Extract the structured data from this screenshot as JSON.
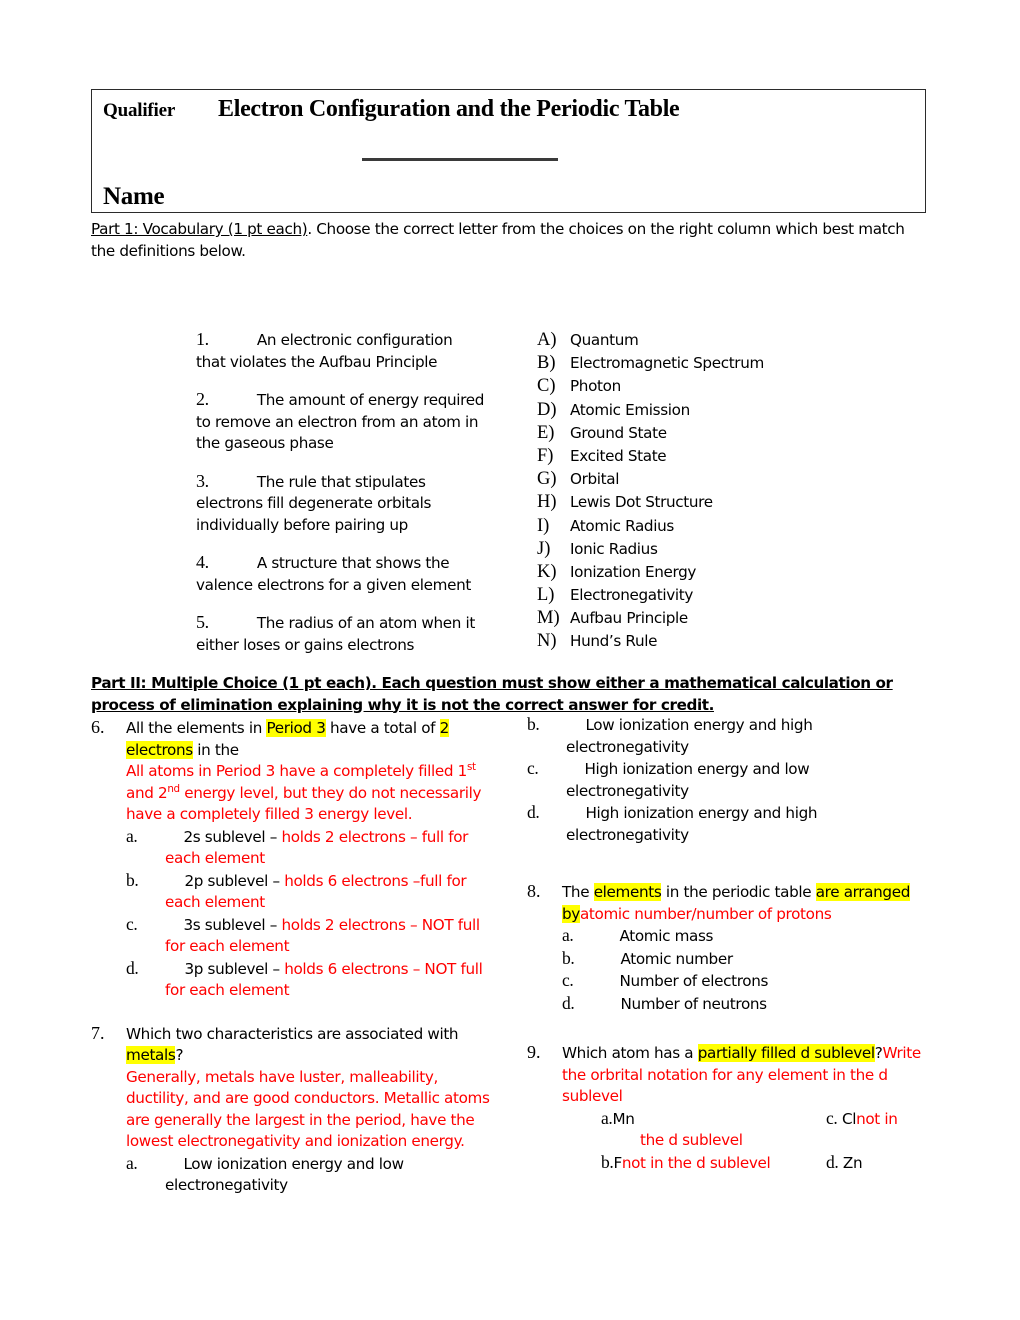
{
  "header": {
    "qualifier": "Qualifier",
    "title": "Electron Configuration and the Periodic Table",
    "name_label": "Name",
    "blank_line": "____________________"
  },
  "part1": {
    "heading_underlined": "Part 1:  Vocabulary (1 pt each)",
    "instructions": ".  Choose the correct letter from the choices on the right column which best match the definitions below.",
    "definitions": [
      {
        "num": "1.",
        "text": "An electronic configuration that violates the Aufbau Principle"
      },
      {
        "num": "2.",
        "text": "The amount of energy required to remove an electron from an atom in the gaseous phase"
      },
      {
        "num": "3.",
        "text": "The rule that stipulates electrons fill degenerate orbitals individually before pairing up"
      },
      {
        "num": "4.",
        "text": "A structure that shows the valence electrons for a given element"
      },
      {
        "num": "5.",
        "text": "The radius of an atom when it either loses or gains electrons"
      }
    ],
    "choices": [
      {
        "letter": "A)",
        "term": "Quantum"
      },
      {
        "letter": "B)",
        "term": "Electromagnetic Spectrum"
      },
      {
        "letter": "C)",
        "term": "Photon"
      },
      {
        "letter": "D)",
        "term": "Atomic Emission"
      },
      {
        "letter": "E)",
        "term": "Ground State"
      },
      {
        "letter": "F)",
        "term": "Excited State"
      },
      {
        "letter": "G)",
        "term": "Orbital"
      },
      {
        "letter": "H)",
        "term": "Lewis Dot Structure"
      },
      {
        "letter": "I)",
        "term": "Atomic Radius"
      },
      {
        "letter": "J)",
        "term": "Ionic Radius"
      },
      {
        "letter": "K)",
        "term": "Ionization Energy"
      },
      {
        "letter": "L)",
        "term": "Electronegativity"
      },
      {
        "letter": "M)",
        "term": "Aufbau Principle"
      },
      {
        "letter": "N)",
        "term": "Hund’s Rule"
      }
    ]
  },
  "part2": {
    "heading": "Part II:  Multiple Choice (1 pt each).  Each question must show either a mathematical calculation or process of elimination explaining why it is not the correct answer for credit."
  },
  "q6": {
    "num": "6.",
    "stem_1": "All the elements in ",
    "stem_hl_1": "Period 3",
    "stem_2": " have a total of ",
    "stem_hl_2a": "2",
    "stem_hl_2b": "electrons",
    "stem_3": " in the",
    "annotation_a": "All atoms in Period 3 have a completely filled 1",
    "annotation_sup1": "st",
    "annotation_b": " and 2",
    "annotation_sup2": "nd",
    "annotation_c": " energy level, but they do not necessarily have a completely filled 3 energy level.",
    "options": [
      {
        "letter": "a.",
        "black": "2s sublevel – ",
        "red": "holds 2 electrons – full for each element"
      },
      {
        "letter": "b.",
        "black": "2p sublevel – ",
        "red": "holds 6 electrons –full for each element"
      },
      {
        "letter": "c.",
        "black": "3s sublevel – ",
        "red": "holds 2 electrons – NOT full for each element"
      },
      {
        "letter": "d.",
        "black": "3p sublevel – ",
        "red": "holds 6 electrons – NOT full for each element"
      }
    ]
  },
  "q7": {
    "num": "7.",
    "stem_1": "Which two characteristics are associated with ",
    "stem_hl": "metals",
    "stem_2": "?",
    "annotation": "Generally, metals have luster, malleability, ductility, and are good conductors. Metallic atoms are generally the largest in the period, have the lowest electronegativity and ionization energy.",
    "options": [
      {
        "letter": "a.",
        "text": "Low ionization energy and low electronegativity"
      },
      {
        "letter": "b.",
        "text": "Low ionization energy and high electronegativity"
      },
      {
        "letter": "c.",
        "text": "High ionization energy and low electronegativity"
      },
      {
        "letter": "d.",
        "text": "High ionization energy and high electronegativity"
      }
    ]
  },
  "q8": {
    "num": "8.",
    "stem_1": "The ",
    "stem_hl_1": "elements",
    "stem_2": " in the periodic table ",
    "stem_hl_2": "are arranged",
    "stem_hl_3": "by",
    "annotation": "atomic number/number of protons",
    "options": [
      {
        "letter": "a.",
        "text": "Atomic mass"
      },
      {
        "letter": "b.",
        "text": "Atomic number"
      },
      {
        "letter": "c.",
        "text": "Number of electrons"
      },
      {
        "letter": "d.",
        "text": "Number of neutrons"
      }
    ]
  },
  "q9": {
    "num": "9.",
    "stem_1": "Which atom has a ",
    "stem_hl": "partially filled d sublevel",
    "stem_2": "?",
    "annotation": "Write the orbrital notation for any element in the d sublevel",
    "opt_a_letter": "a.",
    "opt_a_black": "Mn",
    "opt_c_letter": "c.",
    "opt_c_black": "Cl",
    "opt_c_red": "not in the d sublevel",
    "opt_b_letter": "b.",
    "opt_b_black": "F",
    "opt_b_red": "not in the d sublevel",
    "opt_d_letter": "d.",
    "opt_d_black": "Zn"
  },
  "colors": {
    "annotation_red": "#ff0000",
    "highlight_yellow": "#ffff00",
    "text_black": "#000000"
  }
}
